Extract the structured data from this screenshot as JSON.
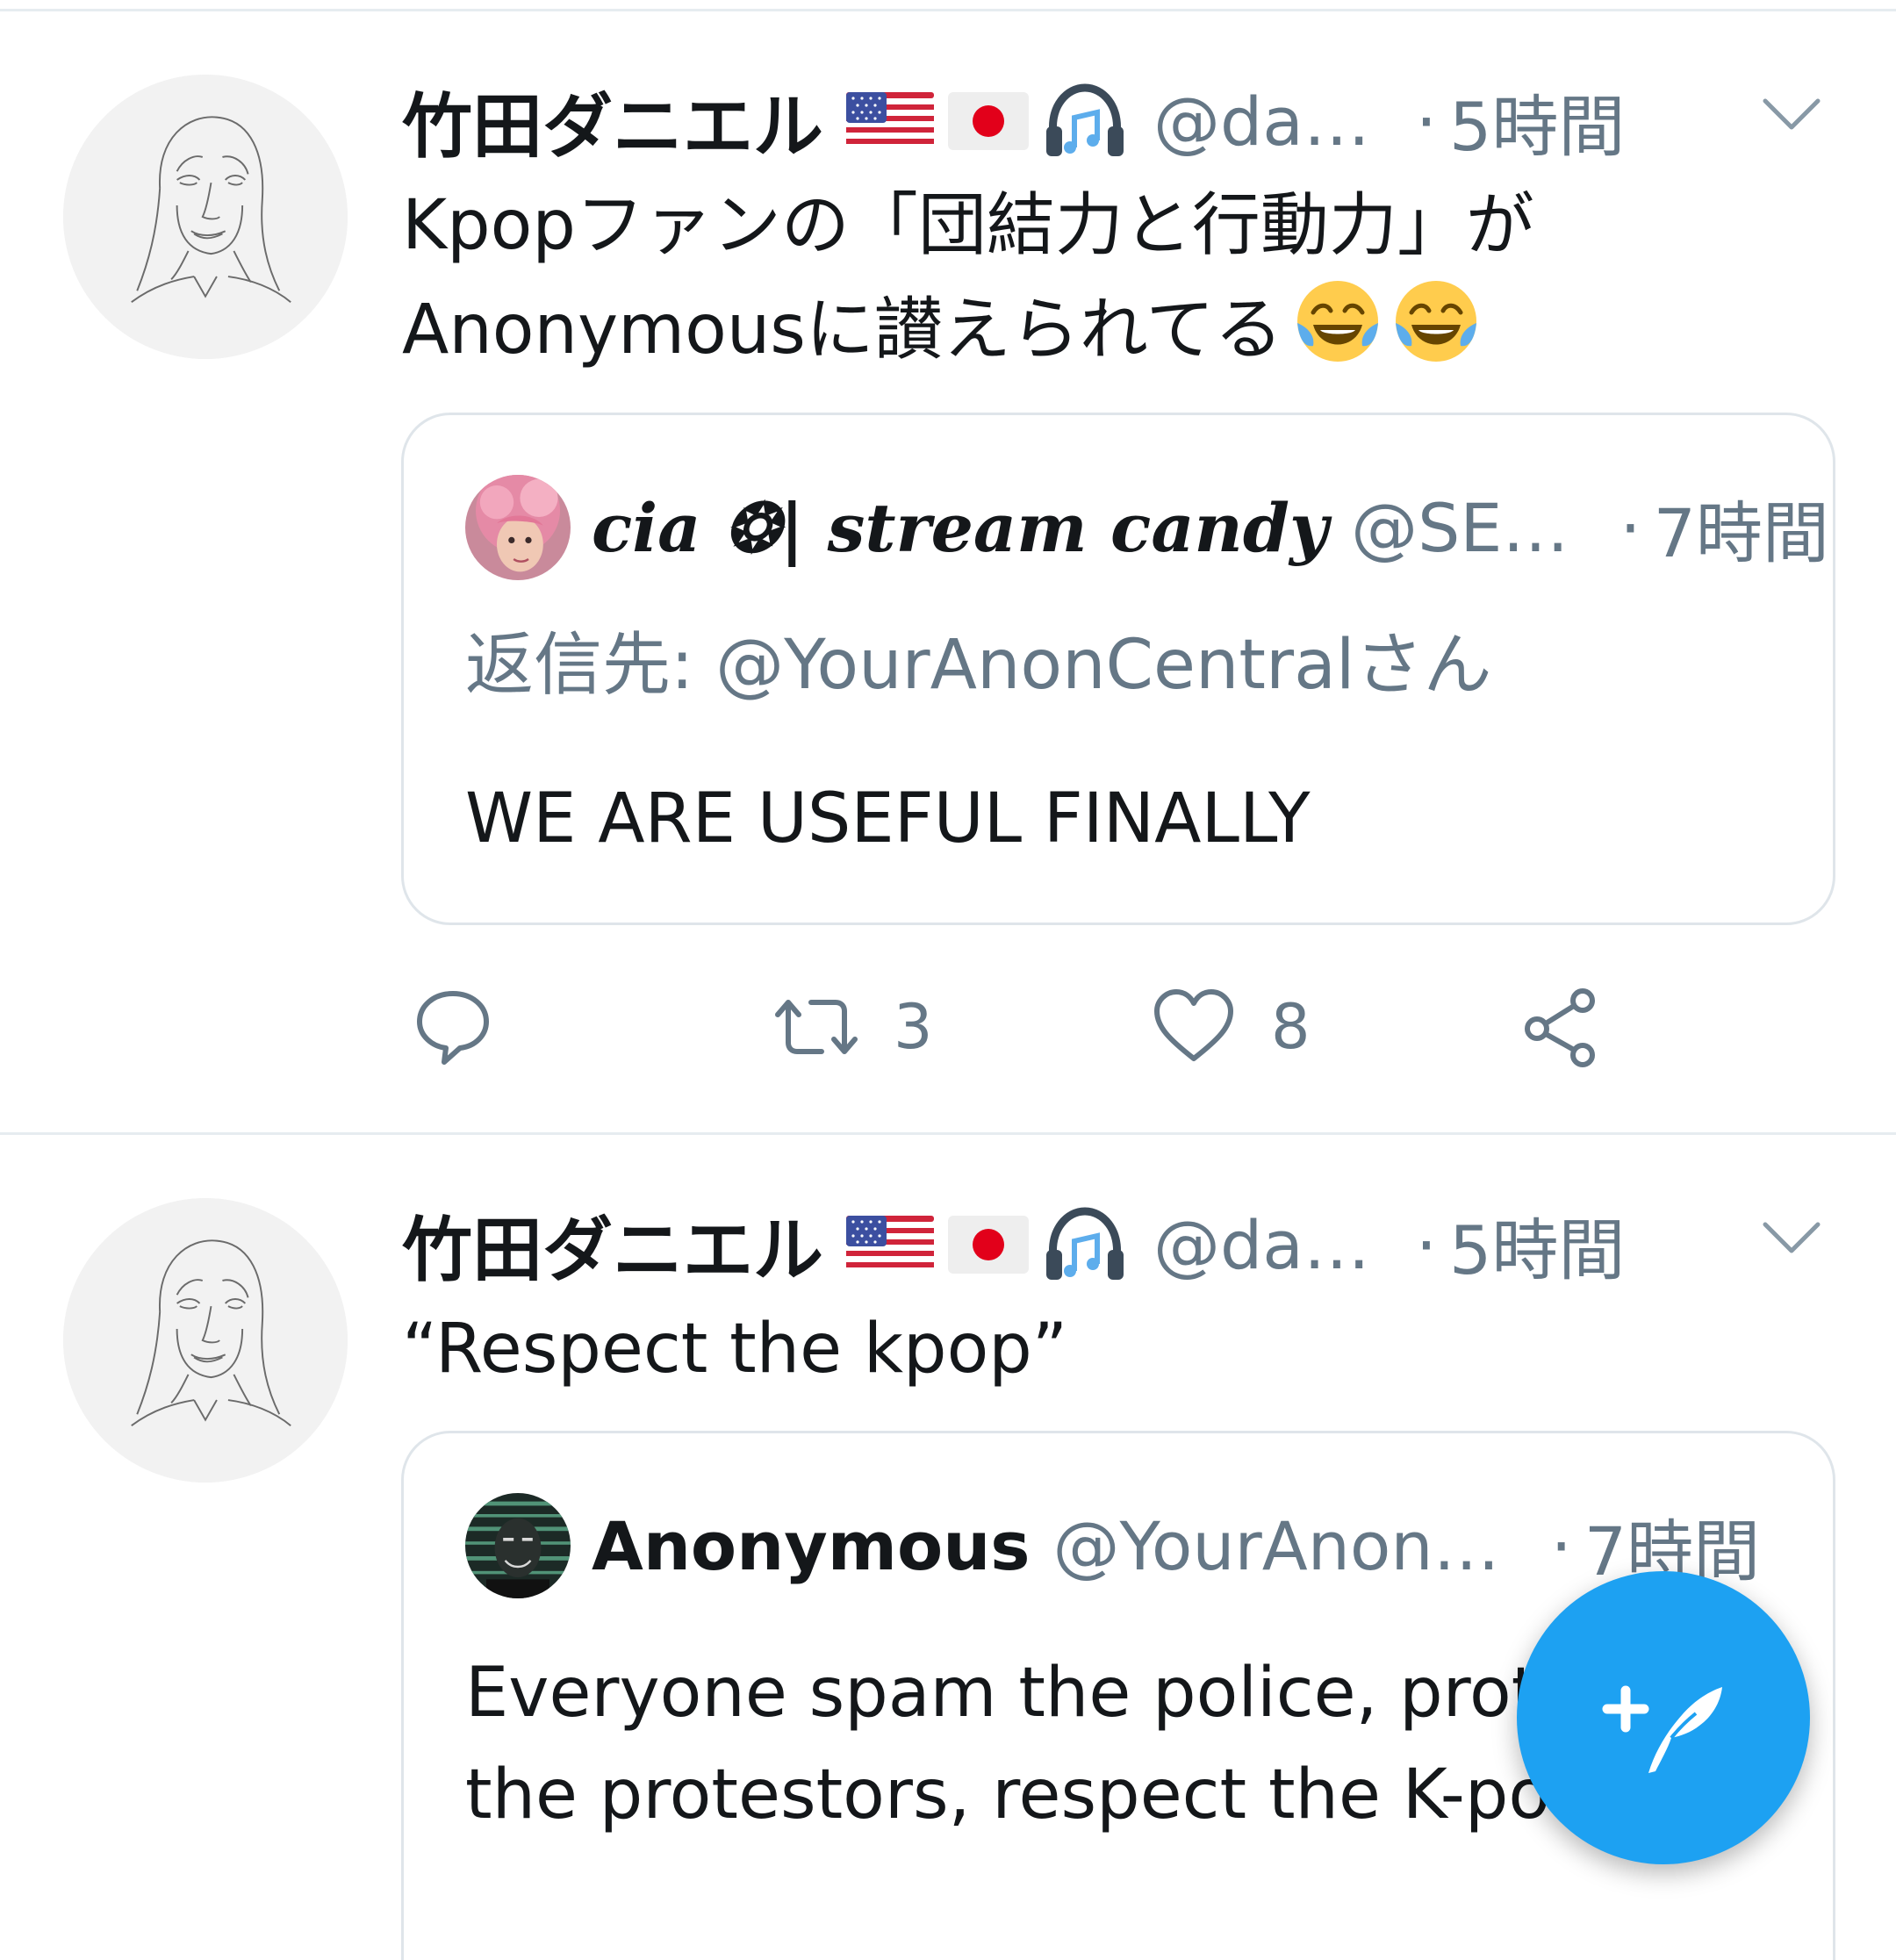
{
  "tweets": [
    {
      "author_name": "竹田ダニエル",
      "handle": "@da…",
      "separator": "·",
      "time": "5時間",
      "text_lines": [
        "Kpopファンの「団結力と行動力」が",
        "Anonymousに讃えられてる"
      ],
      "emojis": [
        "face-with-tears-of-joy",
        "face-with-tears-of-joy"
      ],
      "quoted": {
        "author_name": "cia ❂| stream candy",
        "handle": "@SE…",
        "separator": "·",
        "time": "7時間",
        "reply_to": "返信先: @YourAnonCentralさん",
        "text": "WE ARE USEFUL FINALLY"
      },
      "actions": {
        "reply_count": "",
        "retweet_count": "3",
        "like_count": "8"
      }
    },
    {
      "author_name": "竹田ダニエル",
      "handle": "@da…",
      "separator": "·",
      "time": "5時間",
      "text": "“Respect the kpop”",
      "quoted": {
        "author_name": "Anonymous",
        "handle": "@YourAnon…",
        "separator": "·",
        "time": "7時間",
        "text_lines": [
          "Everyone spam the police, prot",
          "the protestors, respect the K-po"
        ]
      }
    }
  ],
  "compose_button": {
    "icon": "compose-tweet-icon"
  },
  "colors": {
    "accent": "#1da1f2",
    "secondary_text": "#657786",
    "primary_text": "#14171a",
    "divider": "#e6ecf0"
  }
}
